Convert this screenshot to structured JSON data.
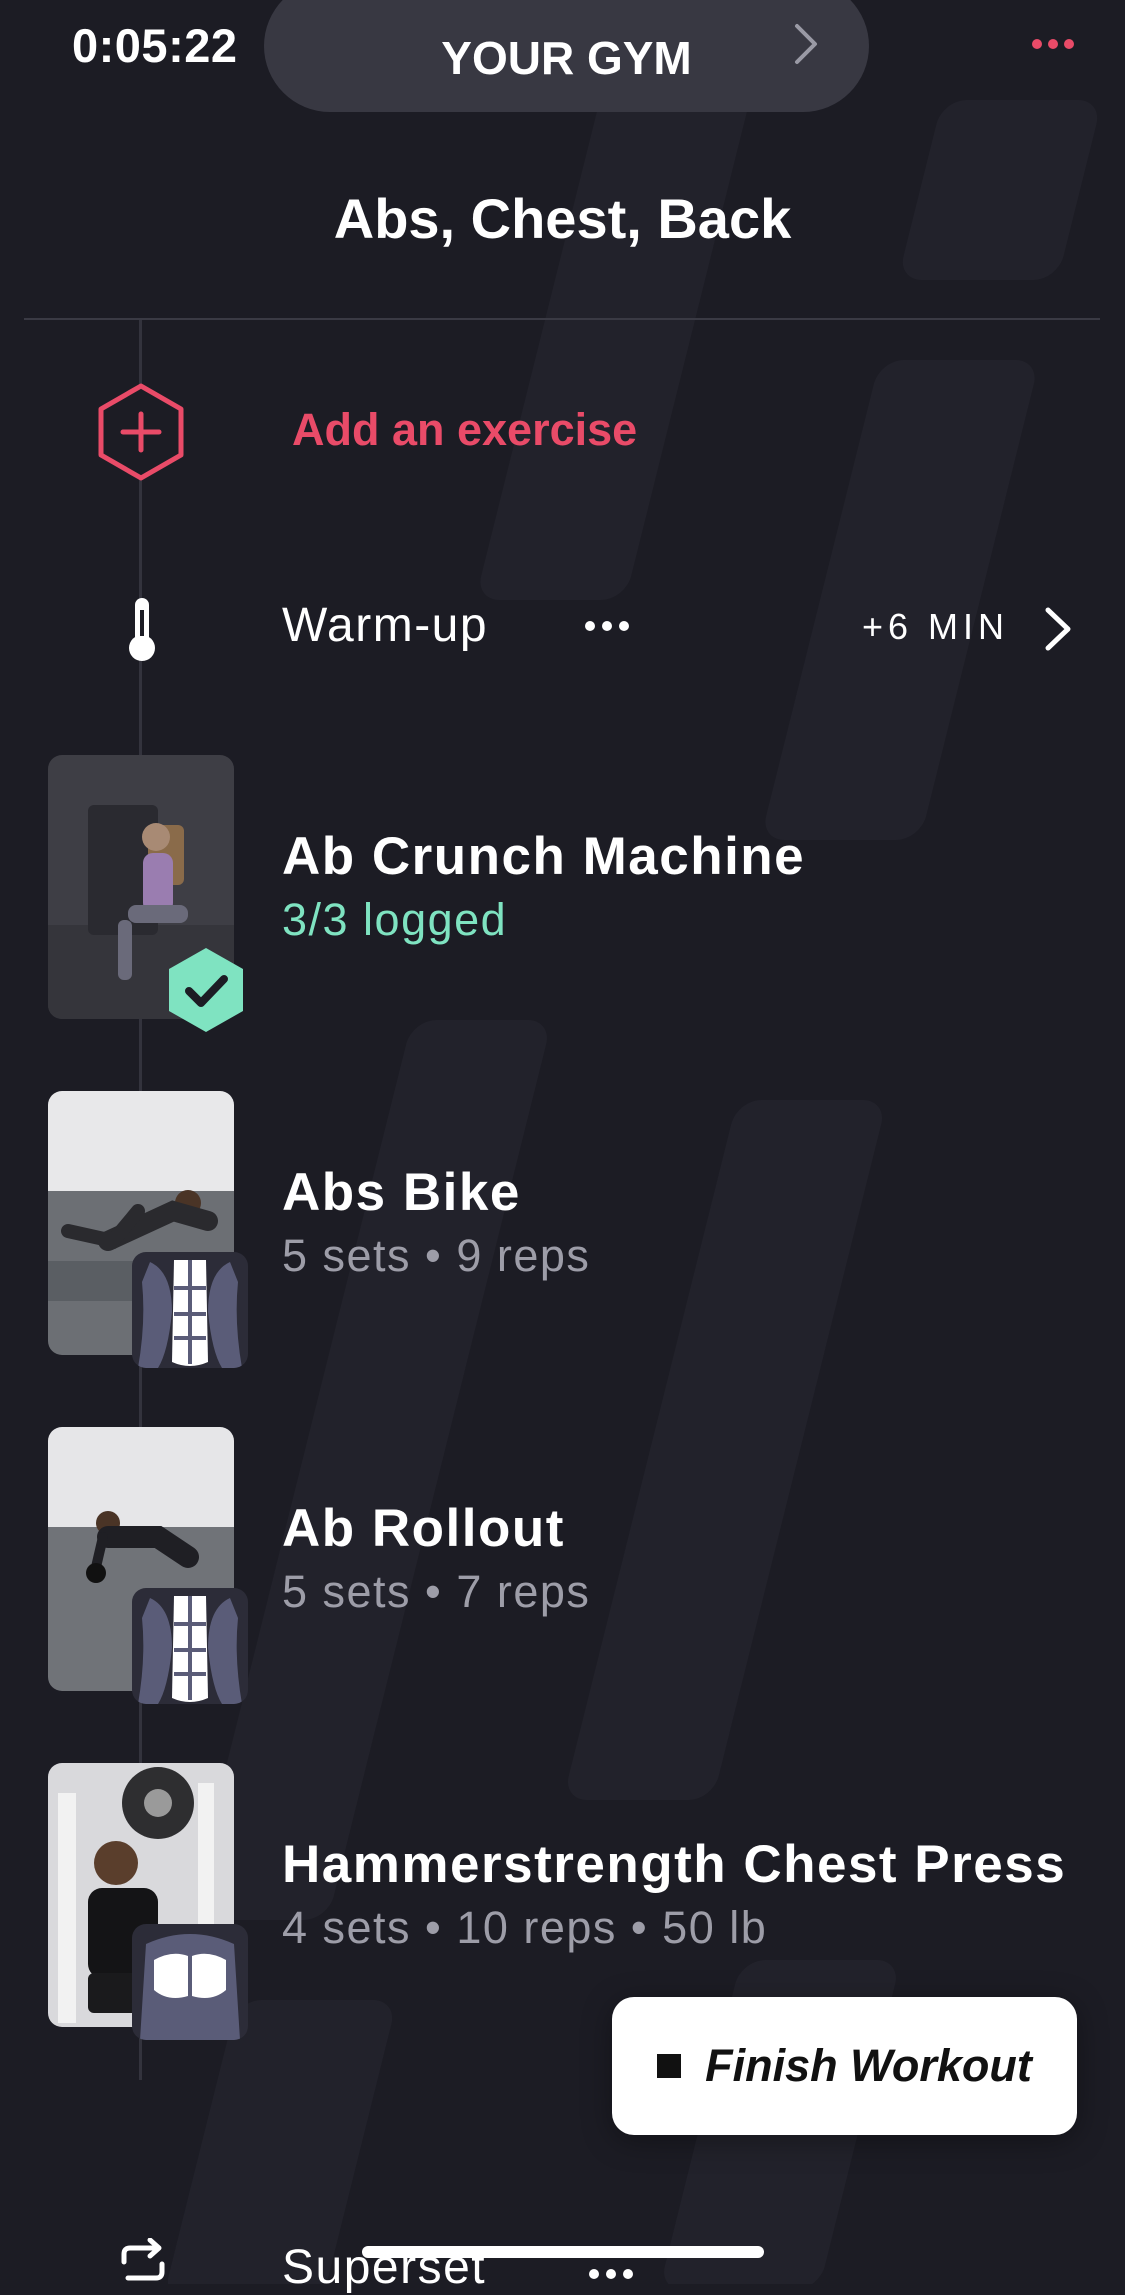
{
  "status_bar": {
    "timer": "0:05:22"
  },
  "header": {
    "gym_label": "YOUR GYM",
    "title": "Abs, Chest, Back",
    "more_icon": "ellipsis-icon"
  },
  "add_exercise": {
    "label": "Add an exercise",
    "icon": "hexagon-plus-icon"
  },
  "warmup": {
    "label": "Warm-up",
    "duration": "+6 MIN",
    "icon": "thermometer-icon"
  },
  "exercises": [
    {
      "name": "Ab Crunch Machine",
      "detail": "3/3 logged",
      "completed": true
    },
    {
      "name": "Abs Bike",
      "detail": "5 sets • 9 reps",
      "completed": false
    },
    {
      "name": "Ab Rollout",
      "detail": "5 sets • 7 reps",
      "completed": false
    },
    {
      "name": "Hammerstrength Chest Press",
      "detail": "4 sets • 10 reps • 50 lb",
      "completed": false
    }
  ],
  "finish_button": {
    "label": "Finish Workout"
  },
  "superset": {
    "label": "Superset",
    "icon": "repeat-icon"
  },
  "colors": {
    "accent": "#e94b68",
    "success": "#7fe3c1",
    "background": "#1c1c24"
  }
}
